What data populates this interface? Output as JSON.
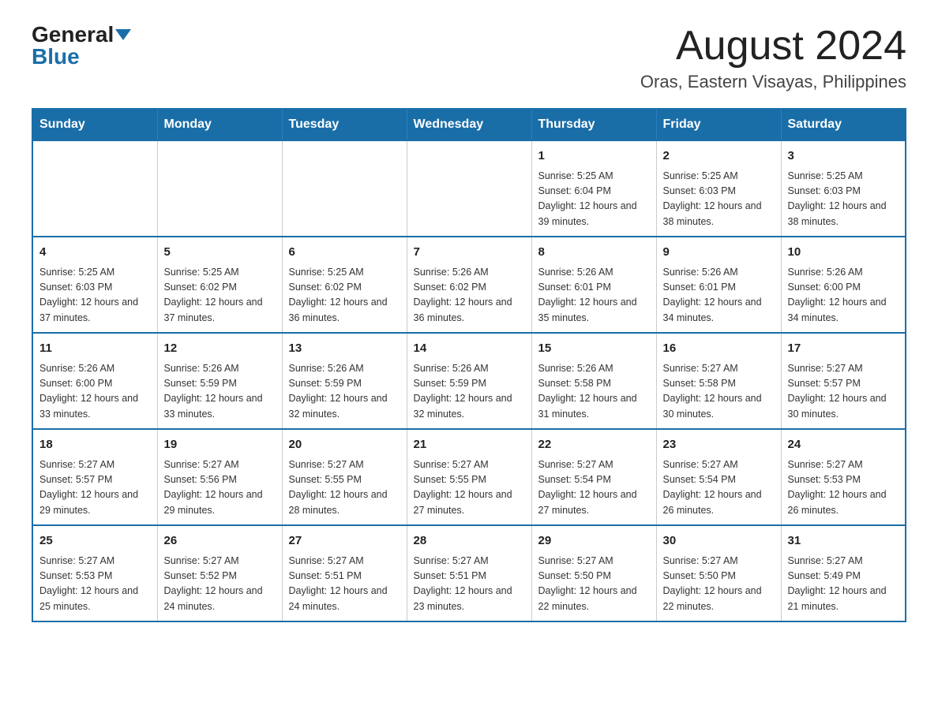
{
  "logo": {
    "general": "General",
    "blue": "Blue"
  },
  "title": {
    "month_year": "August 2024",
    "location": "Oras, Eastern Visayas, Philippines"
  },
  "weekdays": [
    "Sunday",
    "Monday",
    "Tuesday",
    "Wednesday",
    "Thursday",
    "Friday",
    "Saturday"
  ],
  "weeks": [
    [
      {
        "day": "",
        "info": ""
      },
      {
        "day": "",
        "info": ""
      },
      {
        "day": "",
        "info": ""
      },
      {
        "day": "",
        "info": ""
      },
      {
        "day": "1",
        "info": "Sunrise: 5:25 AM\nSunset: 6:04 PM\nDaylight: 12 hours and 39 minutes."
      },
      {
        "day": "2",
        "info": "Sunrise: 5:25 AM\nSunset: 6:03 PM\nDaylight: 12 hours and 38 minutes."
      },
      {
        "day": "3",
        "info": "Sunrise: 5:25 AM\nSunset: 6:03 PM\nDaylight: 12 hours and 38 minutes."
      }
    ],
    [
      {
        "day": "4",
        "info": "Sunrise: 5:25 AM\nSunset: 6:03 PM\nDaylight: 12 hours and 37 minutes."
      },
      {
        "day": "5",
        "info": "Sunrise: 5:25 AM\nSunset: 6:02 PM\nDaylight: 12 hours and 37 minutes."
      },
      {
        "day": "6",
        "info": "Sunrise: 5:25 AM\nSunset: 6:02 PM\nDaylight: 12 hours and 36 minutes."
      },
      {
        "day": "7",
        "info": "Sunrise: 5:26 AM\nSunset: 6:02 PM\nDaylight: 12 hours and 36 minutes."
      },
      {
        "day": "8",
        "info": "Sunrise: 5:26 AM\nSunset: 6:01 PM\nDaylight: 12 hours and 35 minutes."
      },
      {
        "day": "9",
        "info": "Sunrise: 5:26 AM\nSunset: 6:01 PM\nDaylight: 12 hours and 34 minutes."
      },
      {
        "day": "10",
        "info": "Sunrise: 5:26 AM\nSunset: 6:00 PM\nDaylight: 12 hours and 34 minutes."
      }
    ],
    [
      {
        "day": "11",
        "info": "Sunrise: 5:26 AM\nSunset: 6:00 PM\nDaylight: 12 hours and 33 minutes."
      },
      {
        "day": "12",
        "info": "Sunrise: 5:26 AM\nSunset: 5:59 PM\nDaylight: 12 hours and 33 minutes."
      },
      {
        "day": "13",
        "info": "Sunrise: 5:26 AM\nSunset: 5:59 PM\nDaylight: 12 hours and 32 minutes."
      },
      {
        "day": "14",
        "info": "Sunrise: 5:26 AM\nSunset: 5:59 PM\nDaylight: 12 hours and 32 minutes."
      },
      {
        "day": "15",
        "info": "Sunrise: 5:26 AM\nSunset: 5:58 PM\nDaylight: 12 hours and 31 minutes."
      },
      {
        "day": "16",
        "info": "Sunrise: 5:27 AM\nSunset: 5:58 PM\nDaylight: 12 hours and 30 minutes."
      },
      {
        "day": "17",
        "info": "Sunrise: 5:27 AM\nSunset: 5:57 PM\nDaylight: 12 hours and 30 minutes."
      }
    ],
    [
      {
        "day": "18",
        "info": "Sunrise: 5:27 AM\nSunset: 5:57 PM\nDaylight: 12 hours and 29 minutes."
      },
      {
        "day": "19",
        "info": "Sunrise: 5:27 AM\nSunset: 5:56 PM\nDaylight: 12 hours and 29 minutes."
      },
      {
        "day": "20",
        "info": "Sunrise: 5:27 AM\nSunset: 5:55 PM\nDaylight: 12 hours and 28 minutes."
      },
      {
        "day": "21",
        "info": "Sunrise: 5:27 AM\nSunset: 5:55 PM\nDaylight: 12 hours and 27 minutes."
      },
      {
        "day": "22",
        "info": "Sunrise: 5:27 AM\nSunset: 5:54 PM\nDaylight: 12 hours and 27 minutes."
      },
      {
        "day": "23",
        "info": "Sunrise: 5:27 AM\nSunset: 5:54 PM\nDaylight: 12 hours and 26 minutes."
      },
      {
        "day": "24",
        "info": "Sunrise: 5:27 AM\nSunset: 5:53 PM\nDaylight: 12 hours and 26 minutes."
      }
    ],
    [
      {
        "day": "25",
        "info": "Sunrise: 5:27 AM\nSunset: 5:53 PM\nDaylight: 12 hours and 25 minutes."
      },
      {
        "day": "26",
        "info": "Sunrise: 5:27 AM\nSunset: 5:52 PM\nDaylight: 12 hours and 24 minutes."
      },
      {
        "day": "27",
        "info": "Sunrise: 5:27 AM\nSunset: 5:51 PM\nDaylight: 12 hours and 24 minutes."
      },
      {
        "day": "28",
        "info": "Sunrise: 5:27 AM\nSunset: 5:51 PM\nDaylight: 12 hours and 23 minutes."
      },
      {
        "day": "29",
        "info": "Sunrise: 5:27 AM\nSunset: 5:50 PM\nDaylight: 12 hours and 22 minutes."
      },
      {
        "day": "30",
        "info": "Sunrise: 5:27 AM\nSunset: 5:50 PM\nDaylight: 12 hours and 22 minutes."
      },
      {
        "day": "31",
        "info": "Sunrise: 5:27 AM\nSunset: 5:49 PM\nDaylight: 12 hours and 21 minutes."
      }
    ]
  ]
}
